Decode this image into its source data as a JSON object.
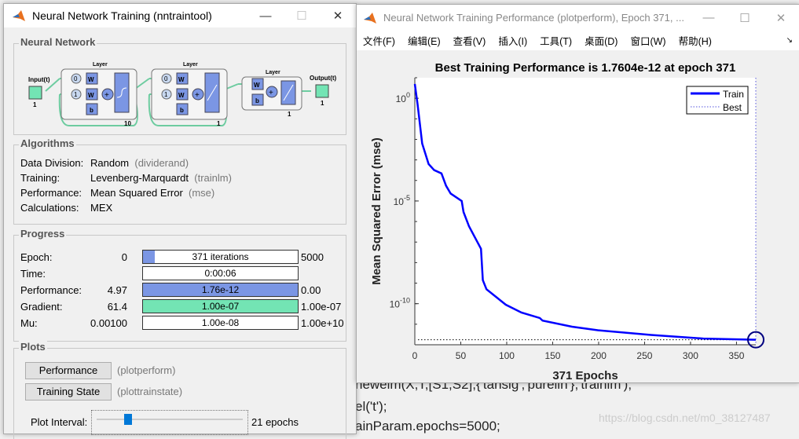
{
  "background_code": [
    "newelm(X,T,[S1,S2],{'tansig','purelin'},'trainlm');",
    "el('t');",
    "ainParam.epochs=5000;"
  ],
  "watermark": "https://blog.csdn.net/m0_38127487",
  "train_window": {
    "title": "Neural Network Training (nntraintool)",
    "controls": {
      "minimize": "—",
      "maximize": "☐",
      "close": "✕"
    },
    "network": {
      "title": "Neural Network",
      "layer_label": "Layer",
      "input_label": "Input(t)",
      "output_label": "Output(t)",
      "input_size": "1",
      "output_size": "1",
      "layer_sizes": [
        "10",
        "1",
        "1"
      ],
      "delay_labels": [
        "0",
        "1"
      ],
      "weight": "W",
      "bias": "b",
      "sum": "+"
    },
    "algorithms": {
      "title": "Algorithms",
      "rows": [
        {
          "label": "Data Division:",
          "value": "Random",
          "fn": "(dividerand)"
        },
        {
          "label": "Training:",
          "value": "Levenberg-Marquardt",
          "fn": "(trainlm)"
        },
        {
          "label": "Performance:",
          "value": "Mean Squared Error",
          "fn": "(mse)"
        },
        {
          "label": "Calculations:",
          "value": "MEX",
          "fn": ""
        }
      ]
    },
    "progress": {
      "title": "Progress",
      "rows": [
        {
          "label": "Epoch:",
          "start": "0",
          "current": "371 iterations",
          "end": "5000",
          "fill": 0.0742,
          "color": "#7b96e4"
        },
        {
          "label": "Time:",
          "start": "",
          "current": "0:00:06",
          "end": "",
          "fill": 0,
          "color": "#ffffff"
        },
        {
          "label": "Performance:",
          "start": "4.97",
          "current": "1.76e-12",
          "end": "0.00",
          "fill": 1,
          "color": "#7b96e4"
        },
        {
          "label": "Gradient:",
          "start": "61.4",
          "current": "1.00e-07",
          "end": "1.00e-07",
          "fill": 1,
          "color": "#73e4b4"
        },
        {
          "label": "Mu:",
          "start": "0.00100",
          "current": "1.00e-08",
          "end": "1.00e+10",
          "fill": 0,
          "color": "#ffffff"
        }
      ]
    },
    "plots": {
      "title": "Plots",
      "buttons": [
        {
          "label": "Performance",
          "fn": "(plotperform)"
        },
        {
          "label": "Training State",
          "fn": "(plottrainstate)"
        }
      ],
      "interval_label": "Plot Interval:",
      "interval_value": "21 epochs",
      "slider_fraction": 0.2
    }
  },
  "plot_window": {
    "title": "Neural Network Training Performance (plotperform), Epoch 371, ...",
    "controls": {
      "minimize": "—",
      "maximize": "☐",
      "close": "✕"
    },
    "menu": [
      "文件(F)",
      "编辑(E)",
      "查看(V)",
      "插入(I)",
      "工具(T)",
      "桌面(D)",
      "窗口(W)",
      "帮助(H)"
    ]
  },
  "chart_data": {
    "type": "line",
    "title": "Best Training Performance is 1.7604e-12 at epoch 371",
    "xlabel": "371 Epochs",
    "ylabel": "Mean Squared Error  (mse)",
    "xlim": [
      0,
      371
    ],
    "ylim": [
      1e-12,
      10
    ],
    "yscale": "log",
    "xticks": [
      0,
      50,
      100,
      150,
      200,
      250,
      300,
      350
    ],
    "yticks": [
      {
        "base": "10",
        "exp": "0",
        "value": 1
      },
      {
        "base": "10",
        "exp": "-5",
        "value": 1e-05
      },
      {
        "base": "10",
        "exp": "-10",
        "value": 1e-10
      }
    ],
    "legend": {
      "position": "top-right",
      "entries": [
        "Train",
        "Best"
      ]
    },
    "series": [
      {
        "name": "Train",
        "color": "#0000ff",
        "x": [
          0,
          3,
          8,
          15,
          21,
          29,
          34,
          39,
          51,
          53,
          59,
          72,
          74,
          78,
          99,
          116,
          136,
          139,
          171,
          199,
          257,
          314,
          371
        ],
        "y": [
          4.97,
          0.51,
          0.0063,
          0.00063,
          0.00032,
          0.00022,
          5.5e-05,
          2.3e-05,
          1e-05,
          2.9e-06,
          5.8e-07,
          4.7e-08,
          1.4e-09,
          5e-10,
          8.9e-11,
          3.7e-11,
          2e-11,
          1.5e-11,
          7.6e-12,
          5.1e-12,
          3e-12,
          2e-12,
          1.7604e-12
        ]
      }
    ],
    "best": {
      "name": "Best",
      "epoch": 371,
      "value": 1.7604e-12,
      "color": "#000080"
    }
  }
}
